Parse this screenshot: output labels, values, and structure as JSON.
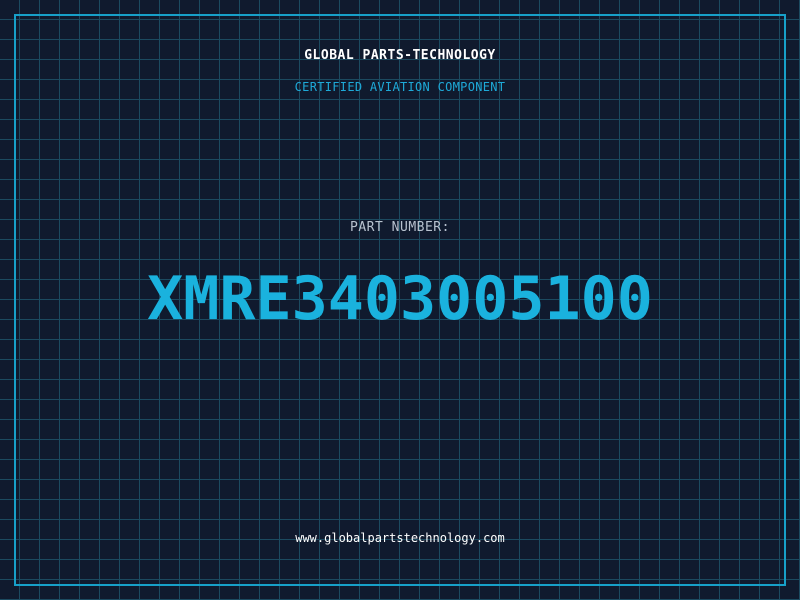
{
  "header": {
    "company_name": "GLOBAL PARTS-TECHNOLOGY",
    "certification": "CERTIFIED AVIATION COMPONENT"
  },
  "part": {
    "label": "PART NUMBER:",
    "number": "XMRE3403005100"
  },
  "footer": {
    "website": "www.globalpartstechnology.com"
  },
  "colors": {
    "background": "#101a2e",
    "grid": "#1c4a60",
    "frame": "#17a0c9",
    "accent": "#1ab2de",
    "heading": "#ffffff",
    "label": "#b8c2cf"
  }
}
